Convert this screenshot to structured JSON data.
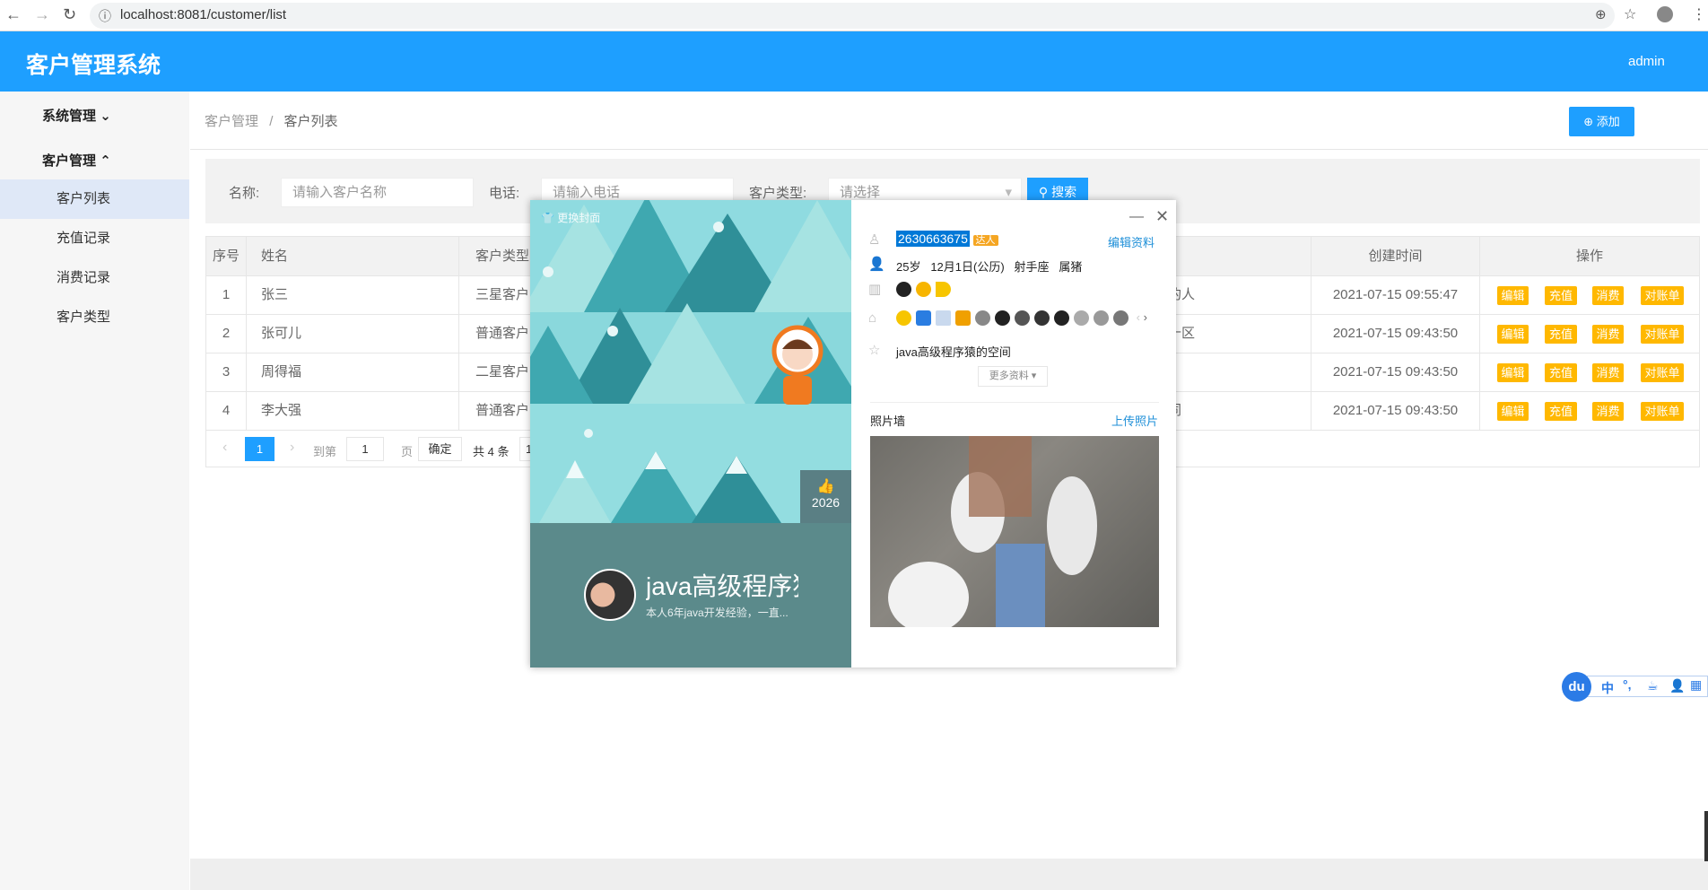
{
  "browser": {
    "url": "localhost:8081/customer/list",
    "icons": [
      "back-icon",
      "forward-icon",
      "reload-icon",
      "info-icon",
      "zoom-icon",
      "star-icon",
      "profile-icon",
      "menu-icon"
    ]
  },
  "header": {
    "title": "客户管理系统",
    "user": "admin"
  },
  "sidebar": {
    "groups": [
      {
        "label": "系统管理",
        "icon": "chevron-down-icon"
      },
      {
        "label": "客户管理",
        "icon": "chevron-up-icon"
      }
    ],
    "items": [
      {
        "label": "客户列表",
        "active": true
      },
      {
        "label": "充值记录"
      },
      {
        "label": "消费记录"
      },
      {
        "label": "客户类型"
      }
    ]
  },
  "breadcrumb": {
    "parent": "客户管理",
    "sep": "/",
    "current": "客户列表"
  },
  "toolbar": {
    "add_label": "添加"
  },
  "search": {
    "name_label": "名称:",
    "name_placeholder": "请输入客户名称",
    "phone_label": "电话:",
    "phone_placeholder": "请输入电话",
    "type_label": "客户类型:",
    "type_placeholder": "请选择",
    "search_label": "搜索"
  },
  "table": {
    "headers": {
      "index": "序号",
      "name": "姓名",
      "type": "客户类型",
      "created": "创建时间",
      "ops": "操作"
    },
    "rows": [
      {
        "index": "1",
        "name": "张三",
        "type": "三星客户",
        "addr": "的人",
        "created": "2021-07-15 09:55:47"
      },
      {
        "index": "2",
        "name": "张可儿",
        "type": "普通客户",
        "addr": "十区",
        "created": "2021-07-15 09:43:50"
      },
      {
        "index": "3",
        "name": "周得福",
        "type": "二星客户",
        "addr": "",
        "created": "2021-07-15 09:43:50"
      },
      {
        "index": "4",
        "name": "李大强",
        "type": "普通客户",
        "addr": "同",
        "created": "2021-07-15 09:43:50"
      }
    ],
    "ops": {
      "edit": "编辑",
      "recharge": "充值",
      "consume": "消费",
      "statement": "对账单"
    }
  },
  "pager": {
    "current": "1",
    "goto_label": "到第",
    "goto_value": "1",
    "page_label": "页",
    "confirm": "确定",
    "total": "共 4 条",
    "size": "1"
  },
  "popup": {
    "change_cover": "更换封面",
    "likes": "2026",
    "name": "java高级程序猿",
    "desc": "本人6年java开发经验，一直...",
    "qq": "2630663675",
    "badge": "达人",
    "edit_profile": "编辑资料",
    "age": "25岁",
    "birthday": "12月1日(公历)",
    "zodiac": "射手座",
    "animal": "属猪",
    "space": "java高级程序猿的空间",
    "more": "更多资料 ▾",
    "photo_wall": "照片墙",
    "upload": "上传照片"
  },
  "ime": {
    "logo": "du",
    "lang": "中",
    "punct": "°,"
  }
}
